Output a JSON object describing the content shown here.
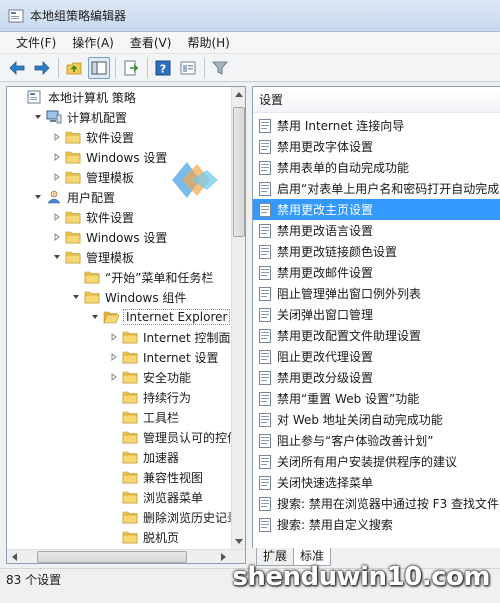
{
  "window": {
    "title": "本地组策略编辑器"
  },
  "menu": [
    "文件(F)",
    "操作(A)",
    "查看(V)",
    "帮助(H)"
  ],
  "toolbar": {
    "buttons": [
      "back-icon",
      "forward-icon",
      "up-folder-icon",
      "show-hide-tree-icon",
      "export-icon",
      "help-icon",
      "properties-icon",
      "filter-icon"
    ]
  },
  "tree": [
    {
      "label": "本地计算机 策略",
      "level": 0,
      "arrow": "",
      "icon": "policy"
    },
    {
      "label": "计算机配置",
      "level": 1,
      "arrow": "down",
      "icon": "computer"
    },
    {
      "label": "软件设置",
      "level": 2,
      "arrow": "right",
      "icon": "folder"
    },
    {
      "label": "Windows 设置",
      "level": 2,
      "arrow": "right",
      "icon": "folder"
    },
    {
      "label": "管理模板",
      "level": 2,
      "arrow": "right",
      "icon": "folder"
    },
    {
      "label": "用户配置",
      "level": 1,
      "arrow": "down",
      "icon": "user"
    },
    {
      "label": "软件设置",
      "level": 2,
      "arrow": "right",
      "icon": "folder"
    },
    {
      "label": "Windows 设置",
      "level": 2,
      "arrow": "right",
      "icon": "folder"
    },
    {
      "label": "管理模板",
      "level": 2,
      "arrow": "down",
      "icon": "folder"
    },
    {
      "label": "“开始”菜单和任务栏",
      "level": 3,
      "arrow": "",
      "icon": "folder"
    },
    {
      "label": "Windows 组件",
      "level": 3,
      "arrow": "down",
      "icon": "folder"
    },
    {
      "label": "Internet Explorer",
      "level": 4,
      "arrow": "down",
      "icon": "folder-open",
      "selected": true
    },
    {
      "label": "Internet 控制面板",
      "level": 5,
      "arrow": "right",
      "icon": "folder"
    },
    {
      "label": "Internet 设置",
      "level": 5,
      "arrow": "right",
      "icon": "folder"
    },
    {
      "label": "安全功能",
      "level": 5,
      "arrow": "right",
      "icon": "folder"
    },
    {
      "label": "持续行为",
      "level": 5,
      "arrow": "",
      "icon": "folder"
    },
    {
      "label": "工具栏",
      "level": 5,
      "arrow": "",
      "icon": "folder"
    },
    {
      "label": "管理员认可的控件",
      "level": 5,
      "arrow": "",
      "icon": "folder"
    },
    {
      "label": "加速器",
      "level": 5,
      "arrow": "",
      "icon": "folder"
    },
    {
      "label": "兼容性视图",
      "level": 5,
      "arrow": "",
      "icon": "folder"
    },
    {
      "label": "浏览器菜单",
      "level": 5,
      "arrow": "",
      "icon": "folder"
    },
    {
      "label": "删除浏览历史记录",
      "level": 5,
      "arrow": "",
      "icon": "folder"
    },
    {
      "label": "脱机页",
      "level": 5,
      "arrow": "",
      "icon": "folder"
    }
  ],
  "list": {
    "header": "设置",
    "items": [
      {
        "label": "禁用 Internet 连接向导"
      },
      {
        "label": "禁用更改字体设置"
      },
      {
        "label": "禁用表单的自动完成功能"
      },
      {
        "label": "启用“对表单上用户名和密码打开自动完成"
      },
      {
        "label": "禁用更改主页设置",
        "selected": true
      },
      {
        "label": "禁用更改语言设置"
      },
      {
        "label": "禁用更改链接颜色设置"
      },
      {
        "label": "禁用更改邮件设置"
      },
      {
        "label": "阻止管理弹出窗口例外列表"
      },
      {
        "label": "关闭弹出窗口管理"
      },
      {
        "label": "禁用更改配置文件助理设置"
      },
      {
        "label": "阻止更改代理设置"
      },
      {
        "label": "禁用更改分级设置"
      },
      {
        "label": "禁用“重置 Web 设置”功能"
      },
      {
        "label": "对 Web 地址关闭自动完成功能"
      },
      {
        "label": "阻止参与“客户体验改善计划”"
      },
      {
        "label": "关闭所有用户安装提供程序的建议"
      },
      {
        "label": "关闭快速选择菜单"
      },
      {
        "label": "搜索: 禁用在浏览器中通过按 F3 查找文件"
      },
      {
        "label": "搜索: 禁用自定义搜索"
      }
    ]
  },
  "tabs": [
    "扩展",
    "标准"
  ],
  "status": "83 个设置",
  "watermark": {
    "bottom": "shenduwin10.com"
  },
  "colors": {
    "selection": "#3399ff",
    "folder": "#f2c94c"
  }
}
